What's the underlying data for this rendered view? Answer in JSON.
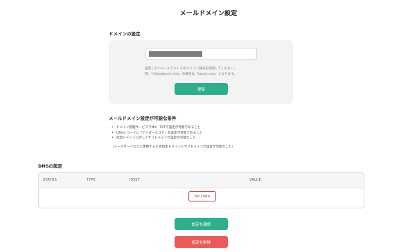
{
  "page": {
    "title": "メールドメイン設定"
  },
  "domain_settings": {
    "heading": "ドメインの設定",
    "input_value": "",
    "hint_lines": [
      "設定したいメールアドレスのドメイン部分を指定してください。",
      "例：「info@tayori.com」の場合は「tayori.com」となります。"
    ],
    "update_button": "更新"
  },
  "conditions": {
    "heading": "メールドメイン設定が可能な条件",
    "items": [
      "ドメイン管理サービスでMX、TXTで設定が可能であること",
      "DNSレコードに「アンダースコア」を設定が可能であること",
      "指定ドメインに対してサブドメインが設定が可能なこと"
    ],
    "note": "（メールサーバなどに使用するため指定ドメインにサブドメインが設定が可能なこと）"
  },
  "dns": {
    "heading": "DNSの設定",
    "columns": [
      "STATUS",
      "TYPE",
      "HOST",
      "VALUE"
    ],
    "empty_text": "No Data"
  },
  "actions": {
    "confirm_button": "設定を確認",
    "delete_button": "設定を削除"
  },
  "colors": {
    "primary_green": "#2fae8e",
    "danger_red": "#ea5a5a",
    "highlight_border": "#e23b3b"
  }
}
